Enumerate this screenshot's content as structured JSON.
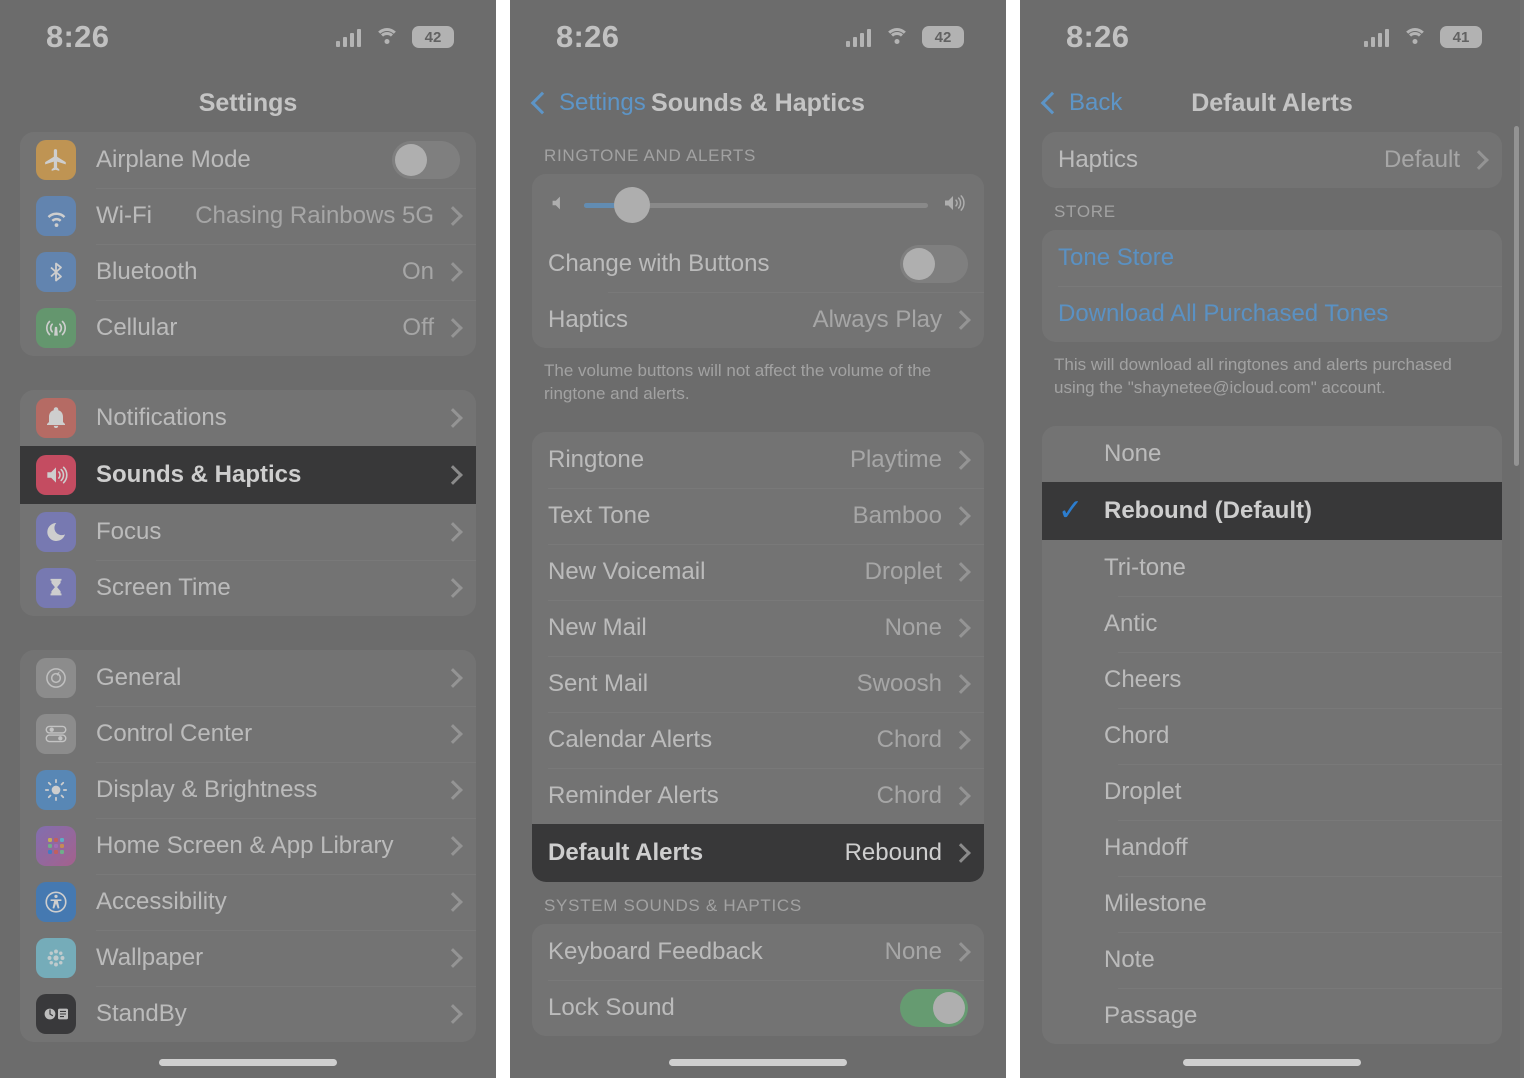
{
  "panels": [
    {
      "id": "settings",
      "status": {
        "time": "8:26",
        "battery": "42"
      },
      "nav": {
        "title": "Settings"
      },
      "groups": [
        {
          "rows": [
            {
              "icon": "airplane-icon",
              "label": "Airplane Mode",
              "control": "toggle-off"
            },
            {
              "icon": "wifi-icon",
              "label": "Wi-Fi",
              "value": "Chasing Rainbows 5G",
              "control": "chevron"
            },
            {
              "icon": "bluetooth-icon",
              "label": "Bluetooth",
              "value": "On",
              "control": "chevron"
            },
            {
              "icon": "cellular-icon",
              "label": "Cellular",
              "value": "Off",
              "control": "chevron"
            }
          ]
        },
        {
          "rows": [
            {
              "icon": "bell-icon",
              "label": "Notifications",
              "value": "",
              "control": "chevron"
            },
            {
              "icon": "speaker-icon",
              "label": "Sounds & Haptics",
              "value": "",
              "control": "chevron",
              "highlight": true
            },
            {
              "icon": "moon-icon",
              "label": "Focus",
              "value": "",
              "control": "chevron"
            },
            {
              "icon": "hourglass-icon",
              "label": "Screen Time",
              "value": "",
              "control": "chevron"
            }
          ]
        },
        {
          "rows": [
            {
              "icon": "gear-icon",
              "label": "General",
              "value": "",
              "control": "chevron"
            },
            {
              "icon": "control-center-icon",
              "label": "Control Center",
              "value": "",
              "control": "chevron"
            },
            {
              "icon": "brightness-icon",
              "label": "Display & Brightness",
              "value": "",
              "control": "chevron"
            },
            {
              "icon": "home-screen-icon",
              "label": "Home Screen & App Library",
              "value": "",
              "control": "chevron"
            },
            {
              "icon": "accessibility-icon",
              "label": "Accessibility",
              "value": "",
              "control": "chevron"
            },
            {
              "icon": "wallpaper-icon",
              "label": "Wallpaper",
              "value": "",
              "control": "chevron"
            },
            {
              "icon": "standby-icon",
              "label": "StandBy",
              "value": "",
              "control": "chevron"
            }
          ]
        }
      ]
    },
    {
      "id": "sounds-haptics",
      "status": {
        "time": "8:26",
        "battery": "42"
      },
      "nav": {
        "back_label": "Settings",
        "title": "Sounds & Haptics"
      },
      "section_header": "RINGTONE AND ALERTS",
      "volume": {
        "percent": 14,
        "left_icon": "speaker-min-icon",
        "right_icon": "speaker-max-icon"
      },
      "volume_rows": [
        {
          "label": "Change with Buttons",
          "control": "toggle-off"
        },
        {
          "label": "Haptics",
          "value": "Always Play",
          "control": "chevron"
        }
      ],
      "footnote": "The volume buttons will not affect the volume of the ringtone and alerts.",
      "tone_rows": [
        {
          "label": "Ringtone",
          "value": "Playtime"
        },
        {
          "label": "Text Tone",
          "value": "Bamboo"
        },
        {
          "label": "New Voicemail",
          "value": "Droplet"
        },
        {
          "label": "New Mail",
          "value": "None"
        },
        {
          "label": "Sent Mail",
          "value": "Swoosh"
        },
        {
          "label": "Calendar Alerts",
          "value": "Chord"
        },
        {
          "label": "Reminder Alerts",
          "value": "Chord"
        },
        {
          "label": "Default Alerts",
          "value": "Rebound",
          "highlight": true
        }
      ],
      "system_header": "SYSTEM SOUNDS & HAPTICS",
      "system_rows": [
        {
          "label": "Keyboard Feedback",
          "value": "None",
          "control": "chevron"
        },
        {
          "label": "Lock Sound",
          "value": "",
          "control": "toggle-on"
        }
      ]
    },
    {
      "id": "default-alerts",
      "status": {
        "time": "8:26",
        "battery": "41"
      },
      "nav": {
        "back_label": "Back",
        "title": "Default Alerts"
      },
      "haptics_row": {
        "label": "Haptics",
        "value": "Default",
        "control": "chevron"
      },
      "store_header": "STORE",
      "store_rows": [
        {
          "label": "Tone Store"
        },
        {
          "label": "Download All Purchased Tones"
        }
      ],
      "store_footnote": "This will download all ringtones and alerts purchased using the \"shaynetee@icloud.com\" account.",
      "tones": [
        {
          "label": "None",
          "selected": false
        },
        {
          "label": "Rebound (Default)",
          "selected": true
        },
        {
          "label": "Tri-tone",
          "selected": false
        },
        {
          "label": "Antic",
          "selected": false
        },
        {
          "label": "Cheers",
          "selected": false
        },
        {
          "label": "Chord",
          "selected": false
        },
        {
          "label": "Droplet",
          "selected": false
        },
        {
          "label": "Handoff",
          "selected": false
        },
        {
          "label": "Milestone",
          "selected": false
        },
        {
          "label": "Note",
          "selected": false
        },
        {
          "label": "Passage",
          "selected": false
        }
      ],
      "checkmark_glyph": "✓"
    }
  ],
  "colors": {
    "accent_blue": "#0a84ff",
    "link_blue": "#4fa3ef",
    "highlight_bg": "#1c1c1e",
    "toggle_on_green": "#62b272",
    "sounds_icon_pink": "#f03a5a"
  }
}
